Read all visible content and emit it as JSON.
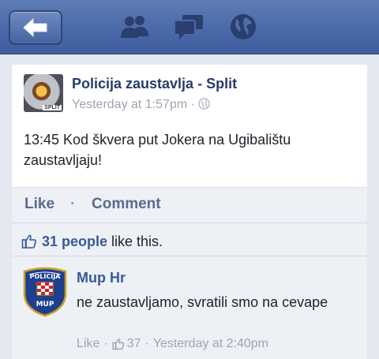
{
  "navbar": {
    "icons": [
      "back-arrow-icon",
      "friends-icon",
      "messages-icon",
      "globe-icon"
    ],
    "color": "#4a69a8"
  },
  "post": {
    "page_name": "Policija zaustavlja - Split",
    "avatar_tag": "SPLIT",
    "timestamp": "Yesterday at 1:57pm",
    "meta_separator": "·",
    "text": "13:45 Kod škvera put Jokera na Ugibalištu zaustavljaju!"
  },
  "actions": {
    "like": "Like",
    "separator": "·",
    "comment": "Comment"
  },
  "likes": {
    "people": "31 people",
    "suffix": "like this."
  },
  "comment": {
    "author": "Mup Hr",
    "avatar_text_top": "POLICIJA",
    "avatar_text_bottom": "MUP",
    "text": "ne zaustavljamo, svratili smo na cevape",
    "like_label": "Like",
    "like_count": "37",
    "separator": "·",
    "timestamp": "Yesterday at 2:40pm"
  }
}
